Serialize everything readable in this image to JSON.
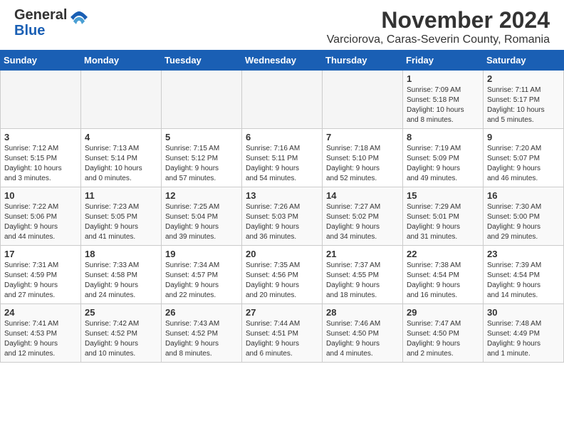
{
  "header": {
    "logo_general": "General",
    "logo_blue": "Blue",
    "month_title": "November 2024",
    "location": "Varciorova, Caras-Severin County, Romania"
  },
  "weekdays": [
    "Sunday",
    "Monday",
    "Tuesday",
    "Wednesday",
    "Thursday",
    "Friday",
    "Saturday"
  ],
  "weeks": [
    [
      {
        "day": "",
        "info": ""
      },
      {
        "day": "",
        "info": ""
      },
      {
        "day": "",
        "info": ""
      },
      {
        "day": "",
        "info": ""
      },
      {
        "day": "",
        "info": ""
      },
      {
        "day": "1",
        "info": "Sunrise: 7:09 AM\nSunset: 5:18 PM\nDaylight: 10 hours\nand 8 minutes."
      },
      {
        "day": "2",
        "info": "Sunrise: 7:11 AM\nSunset: 5:17 PM\nDaylight: 10 hours\nand 5 minutes."
      }
    ],
    [
      {
        "day": "3",
        "info": "Sunrise: 7:12 AM\nSunset: 5:15 PM\nDaylight: 10 hours\nand 3 minutes."
      },
      {
        "day": "4",
        "info": "Sunrise: 7:13 AM\nSunset: 5:14 PM\nDaylight: 10 hours\nand 0 minutes."
      },
      {
        "day": "5",
        "info": "Sunrise: 7:15 AM\nSunset: 5:12 PM\nDaylight: 9 hours\nand 57 minutes."
      },
      {
        "day": "6",
        "info": "Sunrise: 7:16 AM\nSunset: 5:11 PM\nDaylight: 9 hours\nand 54 minutes."
      },
      {
        "day": "7",
        "info": "Sunrise: 7:18 AM\nSunset: 5:10 PM\nDaylight: 9 hours\nand 52 minutes."
      },
      {
        "day": "8",
        "info": "Sunrise: 7:19 AM\nSunset: 5:09 PM\nDaylight: 9 hours\nand 49 minutes."
      },
      {
        "day": "9",
        "info": "Sunrise: 7:20 AM\nSunset: 5:07 PM\nDaylight: 9 hours\nand 46 minutes."
      }
    ],
    [
      {
        "day": "10",
        "info": "Sunrise: 7:22 AM\nSunset: 5:06 PM\nDaylight: 9 hours\nand 44 minutes."
      },
      {
        "day": "11",
        "info": "Sunrise: 7:23 AM\nSunset: 5:05 PM\nDaylight: 9 hours\nand 41 minutes."
      },
      {
        "day": "12",
        "info": "Sunrise: 7:25 AM\nSunset: 5:04 PM\nDaylight: 9 hours\nand 39 minutes."
      },
      {
        "day": "13",
        "info": "Sunrise: 7:26 AM\nSunset: 5:03 PM\nDaylight: 9 hours\nand 36 minutes."
      },
      {
        "day": "14",
        "info": "Sunrise: 7:27 AM\nSunset: 5:02 PM\nDaylight: 9 hours\nand 34 minutes."
      },
      {
        "day": "15",
        "info": "Sunrise: 7:29 AM\nSunset: 5:01 PM\nDaylight: 9 hours\nand 31 minutes."
      },
      {
        "day": "16",
        "info": "Sunrise: 7:30 AM\nSunset: 5:00 PM\nDaylight: 9 hours\nand 29 minutes."
      }
    ],
    [
      {
        "day": "17",
        "info": "Sunrise: 7:31 AM\nSunset: 4:59 PM\nDaylight: 9 hours\nand 27 minutes."
      },
      {
        "day": "18",
        "info": "Sunrise: 7:33 AM\nSunset: 4:58 PM\nDaylight: 9 hours\nand 24 minutes."
      },
      {
        "day": "19",
        "info": "Sunrise: 7:34 AM\nSunset: 4:57 PM\nDaylight: 9 hours\nand 22 minutes."
      },
      {
        "day": "20",
        "info": "Sunrise: 7:35 AM\nSunset: 4:56 PM\nDaylight: 9 hours\nand 20 minutes."
      },
      {
        "day": "21",
        "info": "Sunrise: 7:37 AM\nSunset: 4:55 PM\nDaylight: 9 hours\nand 18 minutes."
      },
      {
        "day": "22",
        "info": "Sunrise: 7:38 AM\nSunset: 4:54 PM\nDaylight: 9 hours\nand 16 minutes."
      },
      {
        "day": "23",
        "info": "Sunrise: 7:39 AM\nSunset: 4:54 PM\nDaylight: 9 hours\nand 14 minutes."
      }
    ],
    [
      {
        "day": "24",
        "info": "Sunrise: 7:41 AM\nSunset: 4:53 PM\nDaylight: 9 hours\nand 12 minutes."
      },
      {
        "day": "25",
        "info": "Sunrise: 7:42 AM\nSunset: 4:52 PM\nDaylight: 9 hours\nand 10 minutes."
      },
      {
        "day": "26",
        "info": "Sunrise: 7:43 AM\nSunset: 4:52 PM\nDaylight: 9 hours\nand 8 minutes."
      },
      {
        "day": "27",
        "info": "Sunrise: 7:44 AM\nSunset: 4:51 PM\nDaylight: 9 hours\nand 6 minutes."
      },
      {
        "day": "28",
        "info": "Sunrise: 7:46 AM\nSunset: 4:50 PM\nDaylight: 9 hours\nand 4 minutes."
      },
      {
        "day": "29",
        "info": "Sunrise: 7:47 AM\nSunset: 4:50 PM\nDaylight: 9 hours\nand 2 minutes."
      },
      {
        "day": "30",
        "info": "Sunrise: 7:48 AM\nSunset: 4:49 PM\nDaylight: 9 hours\nand 1 minute."
      }
    ]
  ]
}
